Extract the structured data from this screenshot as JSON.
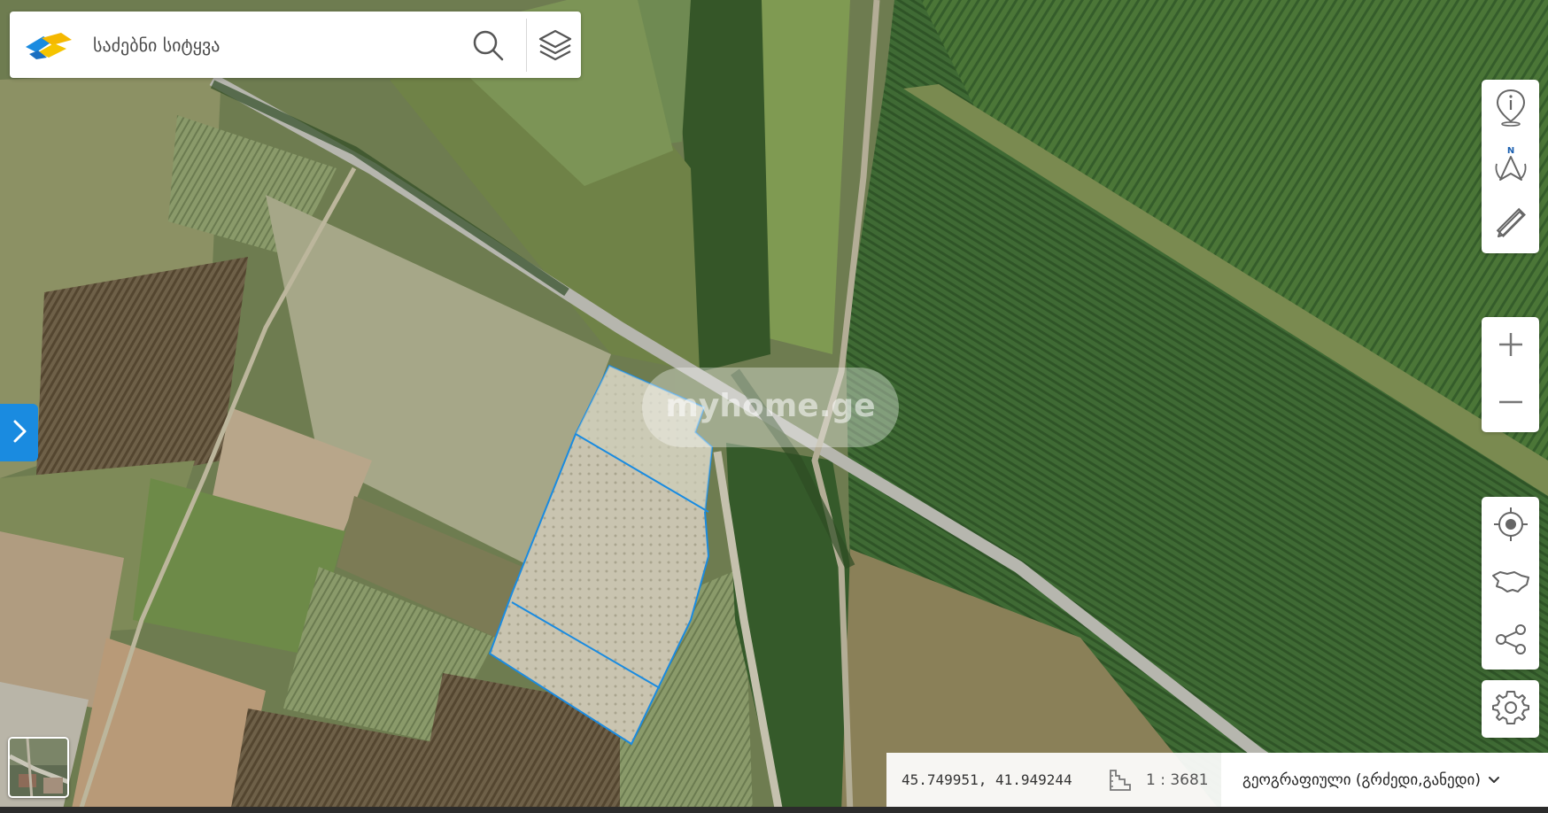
{
  "search": {
    "placeholder": "საძებნი სიტყვა"
  },
  "icons": {
    "logo": "geo-logo-icon",
    "search": "search-icon",
    "layers": "layers-icon",
    "sidebar_toggle": "chevron-right-icon",
    "info": "info-pin-icon",
    "north": "north-arrow-icon",
    "measure": "ruler-pencil-icon",
    "zoom_in": "plus-icon",
    "zoom_out": "minus-icon",
    "locate": "crosshair-icon",
    "country": "country-outline-icon",
    "share": "share-icon",
    "settings": "gear-icon",
    "scale": "scale-icon",
    "dropdown": "chevron-down-icon"
  },
  "toolbar": {
    "north_label": "N"
  },
  "status": {
    "coordinates": "45.749951, 41.949244",
    "scale": "1 : 3681",
    "crs": "გეოგრაფიული (გრძედი,განედი)"
  },
  "watermark": "myhome.ge",
  "colors": {
    "accent": "#1a8be0",
    "parcel_outline": "#1a8be0",
    "parcel_fill": "#e8e8e8"
  }
}
